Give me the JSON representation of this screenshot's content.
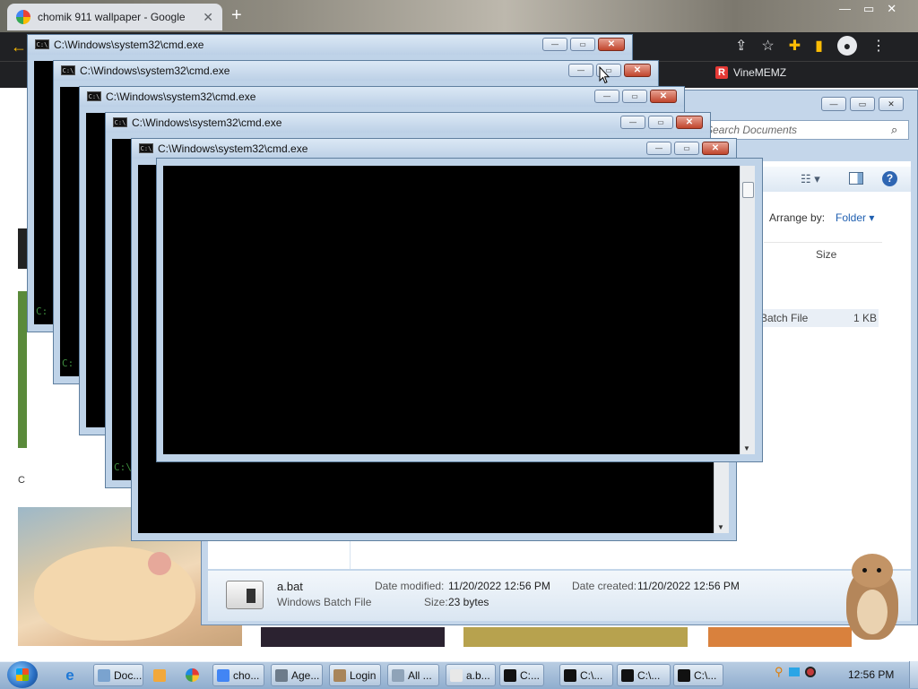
{
  "browser": {
    "tab_title": "chomik 911 wallpaper - Google",
    "tab_close": "✕",
    "new_tab": "+",
    "back": "←",
    "bookmark": "VineMEMZ",
    "bookmark_icon": "R",
    "page_left_text": "C"
  },
  "explorer": {
    "search_placeholder": "Search Documents",
    "arrange_label": "Arrange by:",
    "arrange_value": "Folder ▾",
    "column_size": "Size",
    "file_type_partial": "Batch File",
    "file_size": "1 KB",
    "help": "?",
    "details": {
      "name": "a.bat",
      "type": "Windows Batch File",
      "modified_label": "Date modified:",
      "modified_value": "11/20/2022 12:56 PM",
      "created_label": "Date created:",
      "created_value": "11/20/2022 12:56 PM",
      "size_label": "Size:",
      "size_value": "23 bytes"
    }
  },
  "cmd_windows": [
    {
      "title": "C:\\Windows\\system32\\cmd.exe",
      "prompt": "C:"
    },
    {
      "title": "C:\\Windows\\system32\\cmd.exe",
      "prompt": "C:"
    },
    {
      "title": "C:\\Windows\\system32\\cmd.exe",
      "prompt": ""
    },
    {
      "title": "C:\\Windows\\system32\\cmd.exe",
      "prompt": "C:\\"
    },
    {
      "title": "C:\\Windows\\system32\\cmd.exe",
      "prompt": ""
    }
  ],
  "cmd_icon_label": "C:\\",
  "window_buttons": {
    "minimize": "—",
    "maximize": "▭",
    "close": "✕"
  },
  "taskbar": {
    "items": [
      {
        "label": "Doc...",
        "color": "#7aa3cf"
      },
      {
        "label": "cho...",
        "color": "#4285f4"
      },
      {
        "label": "Age...",
        "color": "#6d7b8a"
      },
      {
        "label": "Login",
        "color": "#a8855a"
      },
      {
        "label": "All ...",
        "color": "#8fa3b8"
      },
      {
        "label": "a.b...",
        "color": "#e8e8e8"
      },
      {
        "label": "C:...",
        "color": "#111111"
      },
      {
        "label": "C:\\...",
        "color": "#111111"
      },
      {
        "label": "C:\\...",
        "color": "#111111"
      },
      {
        "label": "C:\\...",
        "color": "#111111"
      }
    ],
    "clock": "12:56 PM"
  },
  "colors": {
    "accent_blue": "#1f5fb0",
    "close_red": "#c0452c",
    "console_black": "#000000"
  }
}
